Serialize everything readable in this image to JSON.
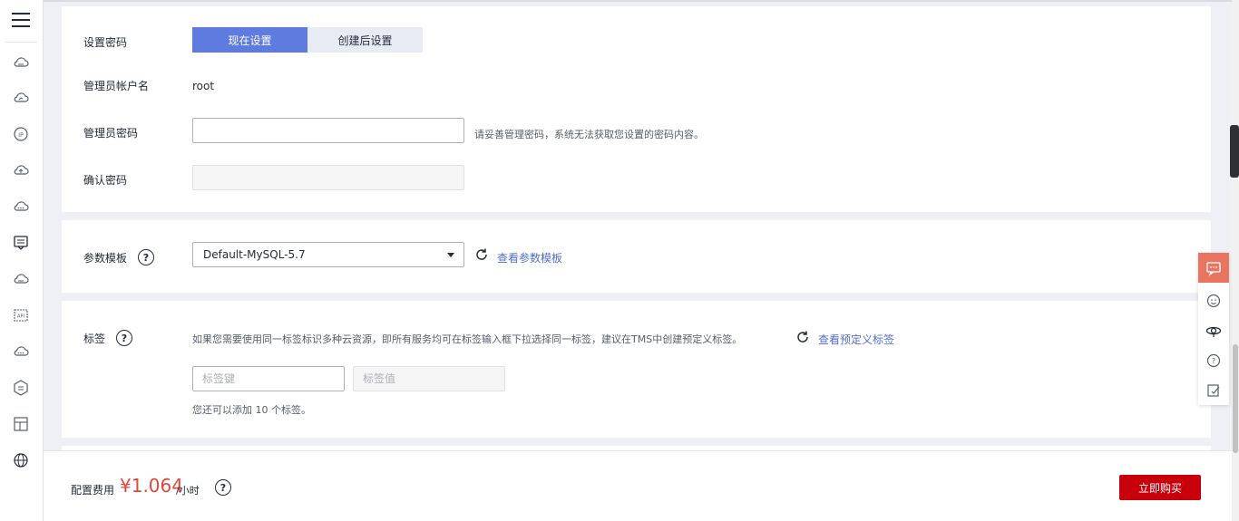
{
  "password_section": {
    "set_password_label": "设置密码",
    "option_now": "现在设置",
    "option_later": "创建后设置",
    "admin_account_label": "管理员帐户名",
    "admin_account_value": "root",
    "admin_password_label": "管理员密码",
    "admin_password_hint": "请妥善管理密码，系统无法获取您设置的密码内容。",
    "confirm_password_label": "确认密码"
  },
  "param_section": {
    "label": "参数模板",
    "selected_template": "Default-MySQL-5.7",
    "view_link": "查看参数模板"
  },
  "tag_section": {
    "label": "标签",
    "description": "如果您需要使用同一标签标识多种云资源，即所有服务均可在标签输入框下拉选择同一标签，建议在TMS中创建预定义标签。",
    "view_link": "查看预定义标签",
    "key_placeholder": "标签键",
    "value_placeholder": "标签值",
    "remaining_hint": "您还可以添加 10 个标签。"
  },
  "footer": {
    "fee_label": "配置费用",
    "price": "¥1.064",
    "unit": "/小时",
    "buy_button": "立即购买"
  },
  "help_glyph": "?",
  "colors": {
    "primary": "#5e7ce0",
    "price": "#e1463c",
    "buy": "#c7000b",
    "link": "#526ecc",
    "float_accent": "#e87560"
  }
}
